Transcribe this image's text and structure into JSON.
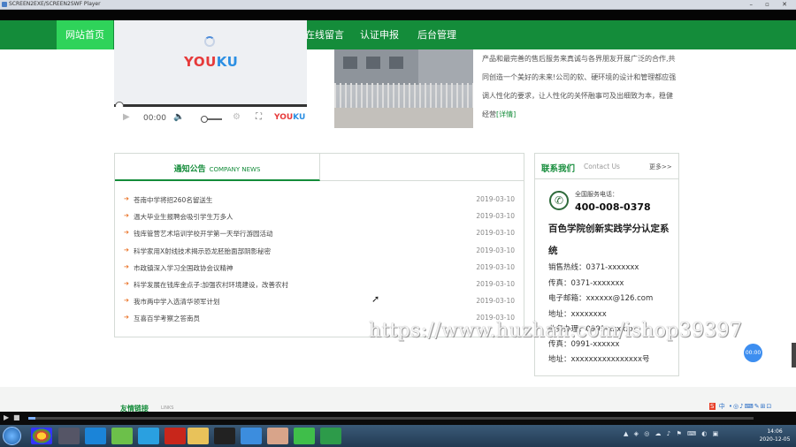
{
  "window": {
    "title": "SCREEN2EXE/SCREEN2SWF Player",
    "controls": "– ▫ ✕"
  },
  "nav": {
    "home": "网站首页",
    "items": [
      "在线留言",
      "认证申报",
      "后台管理"
    ],
    "colors": {
      "bar": "#148c3a",
      "active": "#2fd35a"
    }
  },
  "video": {
    "brand": "YOUKU",
    "brand_small": "YOUKU",
    "time": "00:00",
    "play_icon": "play-icon",
    "volume_icon": "volume-icon",
    "settings_icon": "gear-icon",
    "fullscreen_icon": "fullscreen-icon"
  },
  "intro": {
    "text": "产品和最完善的售后服务来真诚与各界朋友开展广泛的合作,共同创造一个美好的未来!公司的软、硬环境的设计和管理都应强调人性化的要求，让人性化的关怀融事可及出细致为本，稳健经营",
    "more": "[详情]"
  },
  "notice": {
    "tab_cn": "通知公告",
    "tab_en": "COMPANY NEWS",
    "items": [
      {
        "title": "苍南中学将招260名留送生",
        "date": "2019-03-10"
      },
      {
        "title": "温大毕业生报聘会吸引学生万多人",
        "date": "2019-03-10"
      },
      {
        "title": "钱库管营艺术培训学校开学第一天举行游园活动",
        "date": "2019-03-10"
      },
      {
        "title": "科学家用X射线技术揭示恐龙胚胎面部阴影秘密",
        "date": "2019-03-10"
      },
      {
        "title": "市政镇深入学习全国政协会议精神",
        "date": "2019-03-10"
      },
      {
        "title": "科学发展在钱库金点子:加强农村环境建设，改善农村",
        "date": "2019-03-10"
      },
      {
        "title": "我市两中学入选清华领军计划",
        "date": "2019-03-10"
      },
      {
        "title": "互喜百学考察之答南员",
        "date": "2019-03-10"
      }
    ]
  },
  "contact": {
    "title": "联系我们",
    "title_en": "Contact Us",
    "more": "更多>>",
    "hotline_label": "全国服务电话：",
    "hotline": "400-008-0378",
    "company": "百色学院创新实践学分认定系统",
    "lines": [
      "销售热线：0371-xxxxxxx",
      "传真：0371-xxxxxxx",
      "电子邮箱：xxxxxx@126.com",
      "地址：xxxxxxxx",
      "业务办理：0991-xxxxxx",
      "传真：0991-xxxxxx",
      "地址：xxxxxxxxxxxxxxxx号"
    ]
  },
  "watermark": "https://www.huzhan.com/ishop39397",
  "floating_badge": "00:00",
  "footer": {
    "links_title": "友情链接",
    "links_en": "LINKS"
  },
  "ime": {
    "logo": "S",
    "label": "中",
    "icons": "•◎♪⌨✎⊞⊡"
  },
  "taskbar": {
    "clock_time": "14:06",
    "clock_date": "2020-12-05",
    "apps": [
      "chrome",
      "media",
      "browser",
      "edge",
      "chat",
      "flash",
      "folder",
      "qq",
      "cloud",
      "avatar",
      "wechat",
      "player"
    ]
  }
}
